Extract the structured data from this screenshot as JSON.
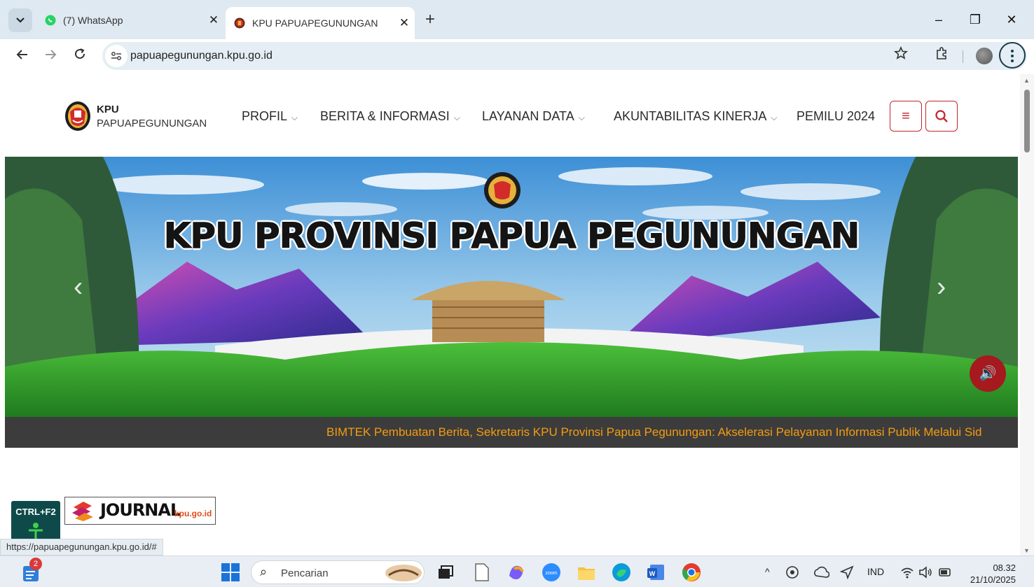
{
  "browser": {
    "tabs": [
      {
        "title": "(7) WhatsApp",
        "active": false,
        "favicon": "whatsapp-icon"
      },
      {
        "title": "KPU PAPUAPEGUNUNGAN",
        "active": true,
        "favicon": "kpu-favicon"
      }
    ],
    "tab_close": "✕",
    "new_tab": "+",
    "window_controls": {
      "minimize": "–",
      "restore": "❐",
      "close": "✕"
    },
    "url": "papuapegunungan.kpu.go.id"
  },
  "site": {
    "brand_top": "KPU",
    "brand_bottom": "PAPUAPEGUNUNGAN",
    "nav": [
      {
        "label": "PROFIL",
        "dropdown": true
      },
      {
        "label": "BERITA & INFORMASI",
        "dropdown": true
      },
      {
        "label": "LAYANAN DATA",
        "dropdown": true
      },
      {
        "label": "AKUNTABILITAS KINERJA",
        "dropdown": true
      },
      {
        "label": "PEMILU 2024",
        "dropdown": false
      }
    ],
    "chevron": "⌵",
    "hamburger": "≡",
    "search_glyph": "⌕"
  },
  "hero": {
    "title": "KPU PROVINSI PAPUA PEGUNUNGAN",
    "prev": "‹",
    "next": "›",
    "sound": "🔊"
  },
  "ticker": {
    "text": "BIMTEK Pembuatan Berita, Sekretaris KPU Provinsi Papua Pegunungan: Akselerasi Pelayanan Informasi Publik Melalui Sid"
  },
  "badges": {
    "ctrl": "CTRL+F2",
    "journal": "JOURNAL",
    "journal_suffix": "kpu.go.id"
  },
  "status_url": "https://papuapegunungan.kpu.go.id/#",
  "taskbar": {
    "search_placeholder": "Pencarian",
    "notification_count": "2",
    "language": "IND",
    "time": "08.32",
    "date": "21/10/2025",
    "chevron_up": "^"
  },
  "colors": {
    "accent_red": "#c2262e",
    "ticker_text": "#f39c12",
    "ticker_bg": "#3c3c3c"
  }
}
